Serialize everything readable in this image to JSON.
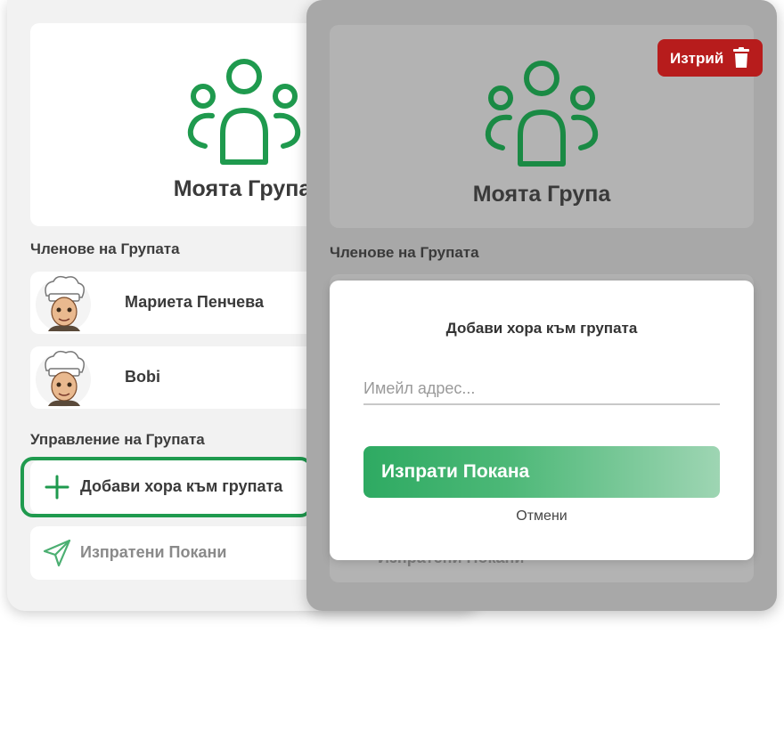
{
  "back_screen": {
    "group_title": "Моята Група",
    "members_heading": "Членове на Групата",
    "members": [
      {
        "name": "Мариета Пенчева"
      },
      {
        "name": "Bobi"
      }
    ],
    "management_heading": "Управление на Групата",
    "add_people_label": "Добави хора към групата",
    "sent_invites_label": "Изпратени Покани"
  },
  "front_screen": {
    "delete_label": "Изтрий",
    "group_title": "Моята Група",
    "members_heading": "Членове на Групата",
    "sent_invites_label": "Изпратени Покани"
  },
  "modal": {
    "title": "Добави хора към групата",
    "email_placeholder": "Имейл адрес...",
    "email_value": "",
    "send_label": "Изпрати Покана",
    "cancel_label": "Отмени"
  },
  "colors": {
    "accent_green": "#1f9a4e",
    "delete_red": "#b71c1c",
    "overlay_gray": "#a8a8a8"
  },
  "icons": {
    "group": "people-group-icon",
    "add": "plus-icon",
    "sent": "paper-plane-icon",
    "delete": "trash-icon"
  }
}
